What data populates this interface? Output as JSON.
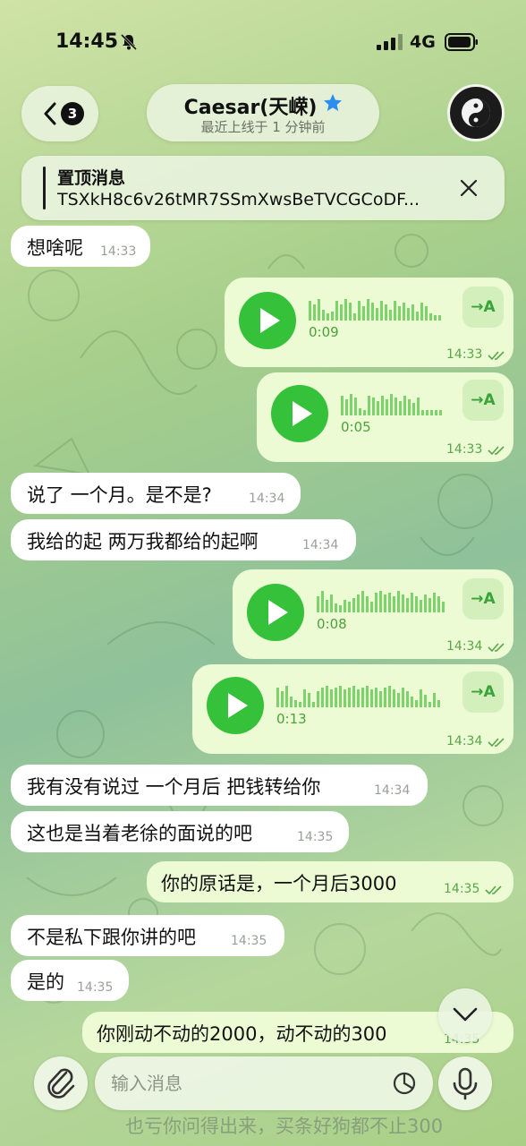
{
  "status_bar": {
    "time": "14:45",
    "network": "4G"
  },
  "header": {
    "back_badge": "3",
    "contact_name": "Caesar(天嵘)",
    "last_seen": "最近上线于 1 分钟前"
  },
  "pinned": {
    "title": "置顶消息",
    "text": "TSXkH8c6v26tMR7SSmXwsBeTVCGCoDF..."
  },
  "messages": {
    "m1": {
      "text": "想啥呢",
      "time": "14:33"
    },
    "v1": {
      "duration": "0:09",
      "time": "14:33",
      "transcribe": "→A"
    },
    "v2": {
      "duration": "0:05",
      "time": "14:33",
      "transcribe": "→A"
    },
    "m2": {
      "text": "说了 一个月。是不是?",
      "time": "14:34"
    },
    "m3": {
      "text": "我给的起 两万我都给的起啊",
      "time": "14:34"
    },
    "v3": {
      "duration": "0:08",
      "time": "14:34",
      "transcribe": "→A"
    },
    "v4": {
      "duration": "0:13",
      "time": "14:34",
      "transcribe": "→A"
    },
    "m4": {
      "text": "我有没有说过 一个月后 把钱转给你",
      "time": "14:34"
    },
    "m5": {
      "text": "这也是当着老徐的面说的吧",
      "time": "14:35"
    },
    "m6": {
      "text": "你的原话是，一个月后3000",
      "time": "14:35"
    },
    "m7": {
      "text": "不是私下跟你讲的吧",
      "time": "14:35"
    },
    "m8": {
      "text": "是的",
      "time": "14:35"
    },
    "m9": {
      "text": "你刚动不动的2000，动不动的300",
      "time": "14:35"
    },
    "m10": {
      "text": "也亏你问得出来，买条好狗都不止300"
    }
  },
  "composer": {
    "placeholder": "输入消息"
  },
  "colors": {
    "accent_green": "#35c23a",
    "outgoing_bubble": "#ecfbd3",
    "incoming_bubble": "#ffffff",
    "star": "#2d8cf0"
  },
  "icons": [
    "bell-muted-icon",
    "signal-icon",
    "battery-icon",
    "back-chevron-icon",
    "star-icon",
    "close-icon",
    "play-icon",
    "double-check-icon",
    "chevron-down-icon",
    "paperclip-icon",
    "sticker-icon",
    "microphone-icon"
  ]
}
